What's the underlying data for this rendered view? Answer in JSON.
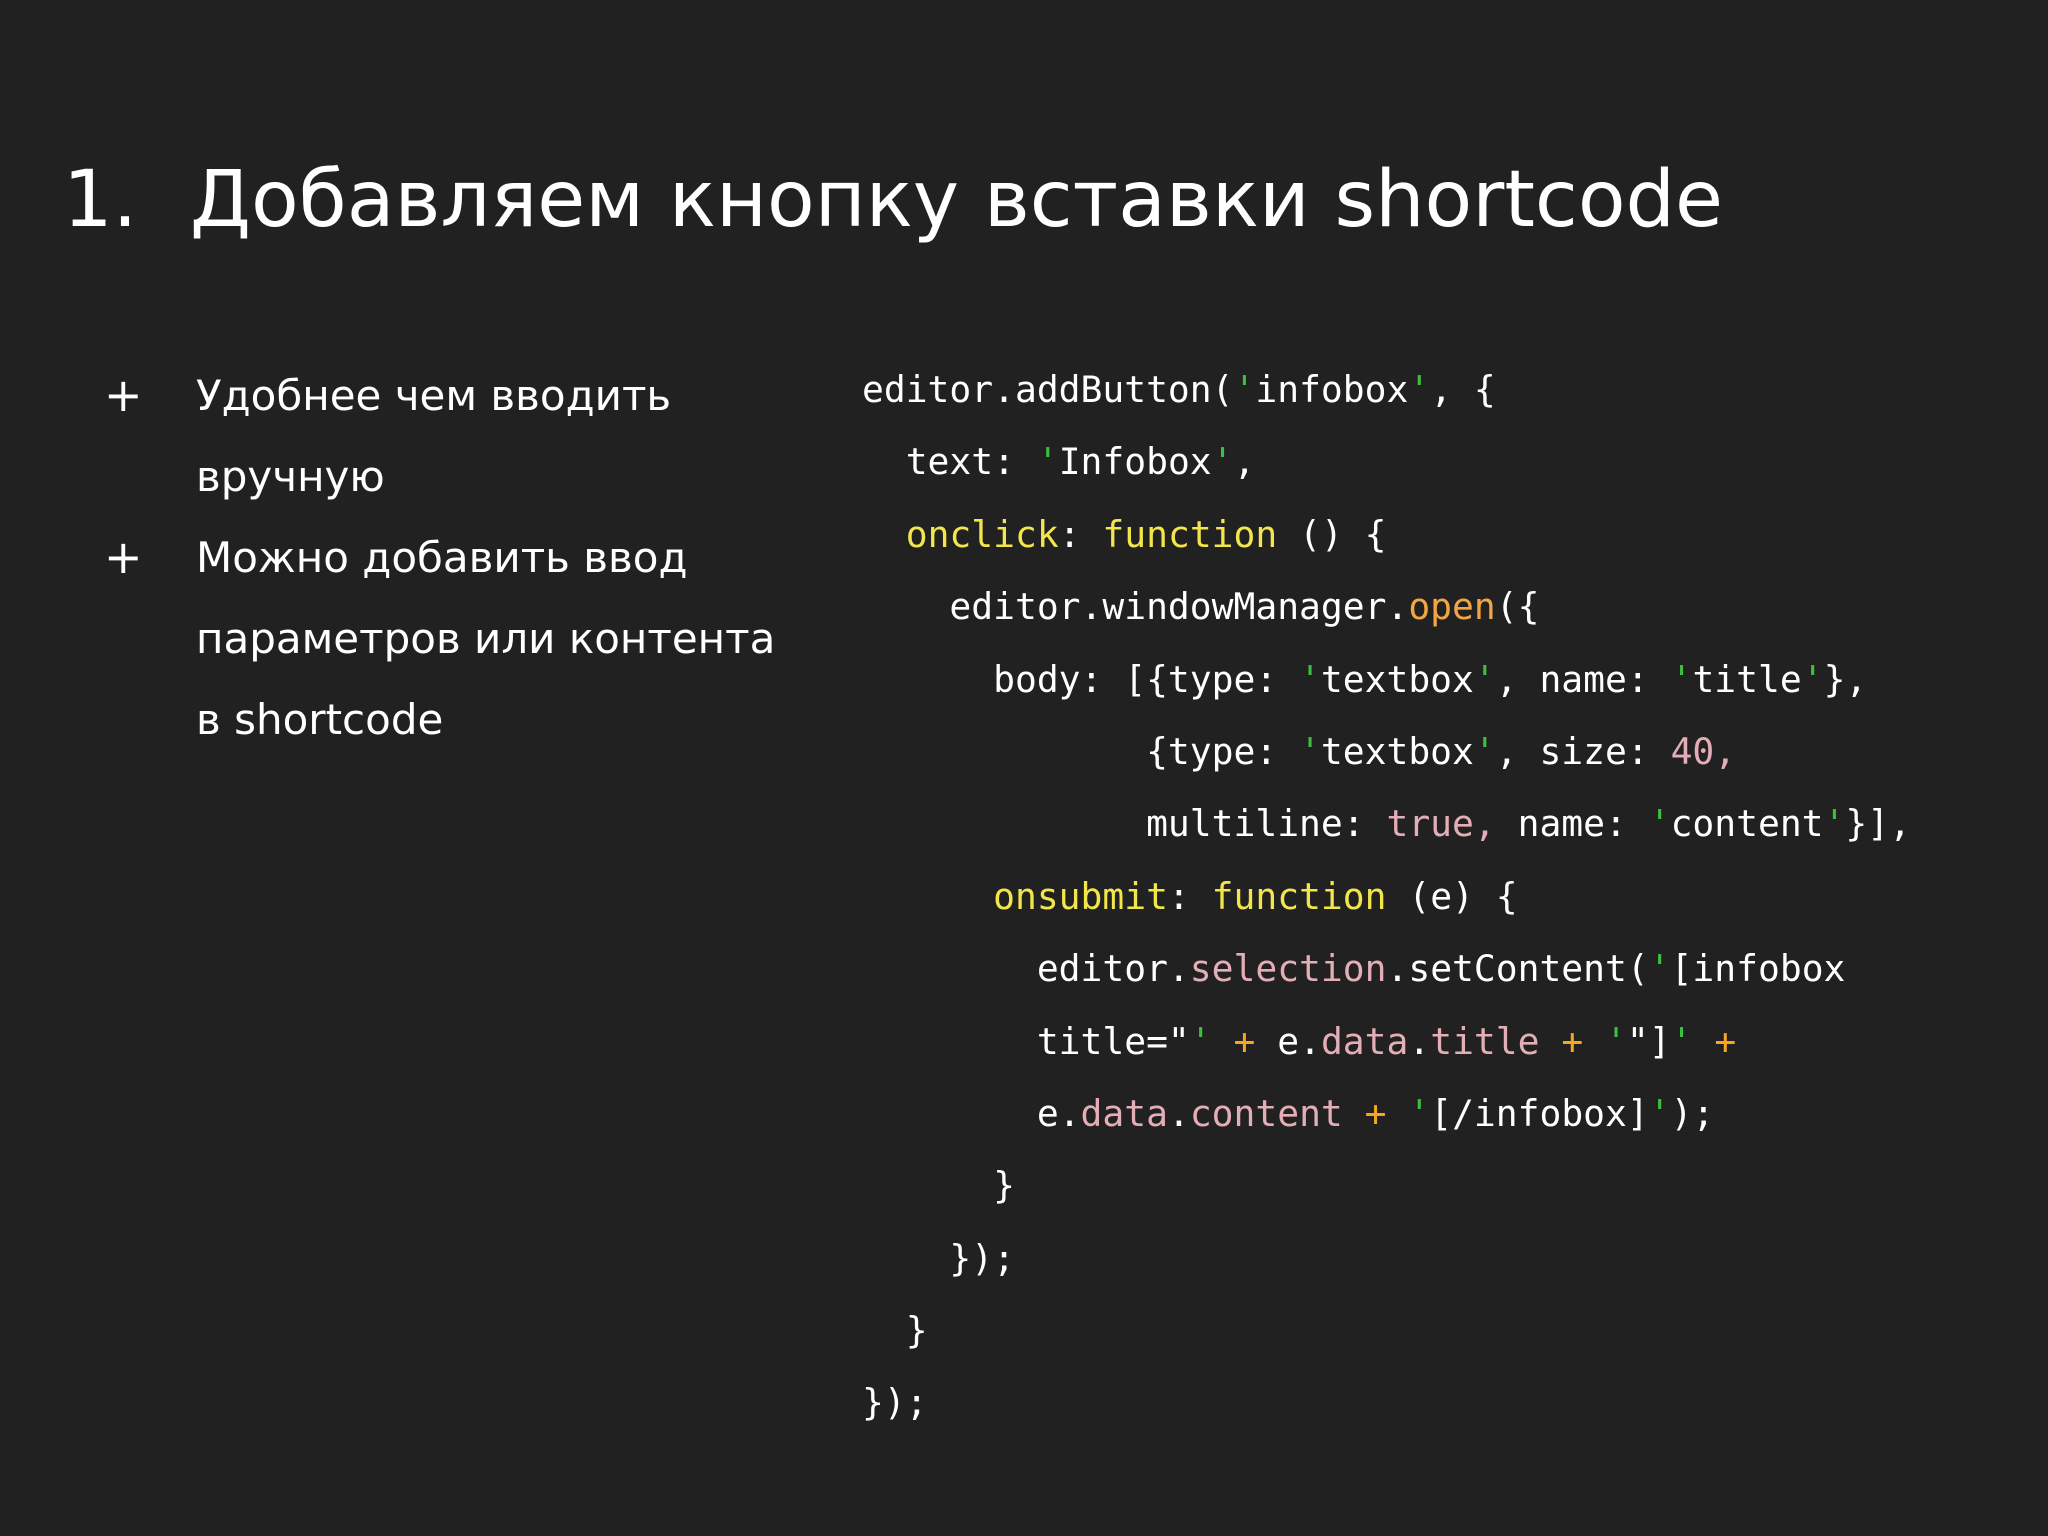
{
  "slide": {
    "title_number": "1.",
    "title_text": "Добавляем кнопку вставки shortcode",
    "bullets": [
      {
        "mark": "+",
        "text": "Удобнее чем вводить\nвручную"
      },
      {
        "mark": "+",
        "text": "Можно добавить ввод\nпараметров или контента\nв shortcode"
      }
    ]
  },
  "code": {
    "colors": {
      "plain": "#ffffff",
      "quote": "#3fbf3f",
      "keyword": "#f2e64a",
      "function": "#f2a641",
      "property": "#e4aeb6",
      "operator": "#f5a623"
    },
    "lines": [
      [
        [
          "plain",
          "editor.addButton("
        ],
        [
          "quote",
          "'"
        ],
        [
          "plain",
          "infobox"
        ],
        [
          "quote",
          "'"
        ],
        [
          "plain",
          ", {"
        ]
      ],
      [
        [
          "plain",
          "  text: "
        ],
        [
          "quote",
          "'"
        ],
        [
          "plain",
          "Infobox"
        ],
        [
          "quote",
          "'"
        ],
        [
          "plain",
          ","
        ]
      ],
      [
        [
          "plain",
          "  "
        ],
        [
          "kw",
          "onclick"
        ],
        [
          "plain",
          ": "
        ],
        [
          "kw",
          "function"
        ],
        [
          "plain",
          " () {"
        ]
      ],
      [
        [
          "plain",
          "    editor.windowManager."
        ],
        [
          "fn",
          "open"
        ],
        [
          "plain",
          "({"
        ]
      ],
      [
        [
          "plain",
          "      body: [{type: "
        ],
        [
          "quote",
          "'"
        ],
        [
          "plain",
          "textbox"
        ],
        [
          "quote",
          "'"
        ],
        [
          "plain",
          ", name: "
        ],
        [
          "quote",
          "'"
        ],
        [
          "plain",
          "title"
        ],
        [
          "quote",
          "'"
        ],
        [
          "plain",
          "},"
        ]
      ],
      [
        [
          "plain",
          "             {type: "
        ],
        [
          "quote",
          "'"
        ],
        [
          "plain",
          "textbox"
        ],
        [
          "quote",
          "'"
        ],
        [
          "plain",
          ", size: "
        ],
        [
          "prop",
          "40,"
        ]
      ],
      [
        [
          "plain",
          "             multiline: "
        ],
        [
          "prop",
          "true,"
        ],
        [
          "plain",
          " name: "
        ],
        [
          "quote",
          "'"
        ],
        [
          "plain",
          "content"
        ],
        [
          "quote",
          "'"
        ],
        [
          "plain",
          "}],"
        ]
      ],
      [
        [
          "plain",
          "      "
        ],
        [
          "kw",
          "onsubmit"
        ],
        [
          "plain",
          ": "
        ],
        [
          "kw",
          "function"
        ],
        [
          "plain",
          " (e) {"
        ]
      ],
      [
        [
          "plain",
          "        editor."
        ],
        [
          "prop",
          "selection"
        ],
        [
          "plain",
          ".setContent("
        ],
        [
          "quote",
          "'"
        ],
        [
          "plain",
          "[infobox"
        ]
      ],
      [
        [
          "plain",
          "        title=\""
        ],
        [
          "quote",
          "'"
        ],
        [
          "plain",
          " "
        ],
        [
          "op",
          "+"
        ],
        [
          "plain",
          " e."
        ],
        [
          "prop",
          "data"
        ],
        [
          "plain",
          "."
        ],
        [
          "prop",
          "title"
        ],
        [
          "plain",
          " "
        ],
        [
          "op",
          "+"
        ],
        [
          "plain",
          " "
        ],
        [
          "quote",
          "'"
        ],
        [
          "plain",
          "\"]"
        ],
        [
          "quote",
          "'"
        ],
        [
          "plain",
          " "
        ],
        [
          "op",
          "+"
        ]
      ],
      [
        [
          "plain",
          "        e."
        ],
        [
          "prop",
          "data"
        ],
        [
          "plain",
          "."
        ],
        [
          "prop",
          "content"
        ],
        [
          "plain",
          " "
        ],
        [
          "op",
          "+"
        ],
        [
          "plain",
          " "
        ],
        [
          "quote",
          "'"
        ],
        [
          "plain",
          "[/infobox]"
        ],
        [
          "quote",
          "'"
        ],
        [
          "plain",
          ");"
        ]
      ],
      [
        [
          "plain",
          "      }"
        ]
      ],
      [
        [
          "plain",
          "    });"
        ]
      ],
      [
        [
          "plain",
          "  }"
        ]
      ],
      [
        [
          "plain",
          "});"
        ]
      ]
    ]
  }
}
